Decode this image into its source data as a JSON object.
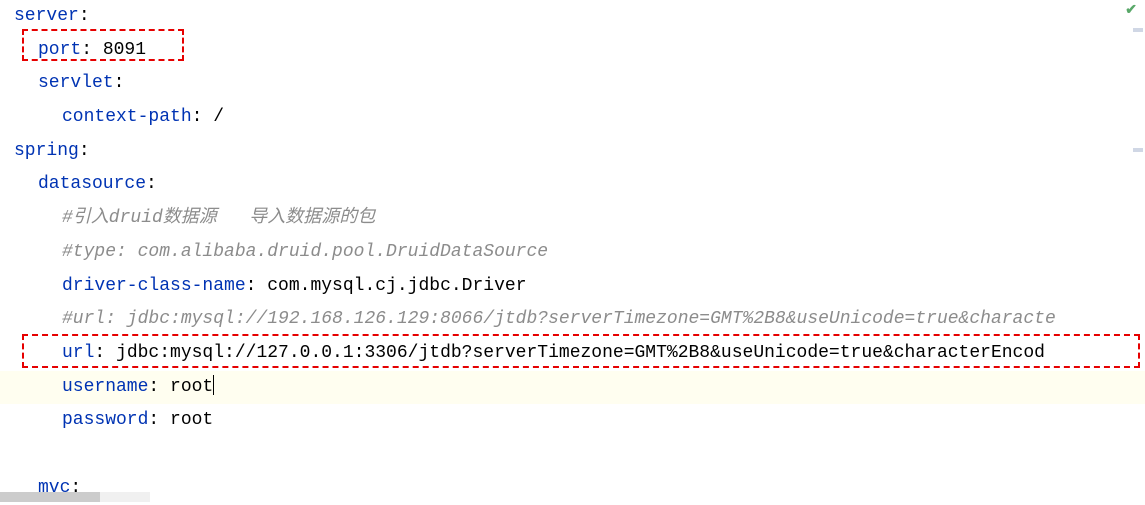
{
  "checkIcon": "✔",
  "lines": {
    "l1_key": "server",
    "l2_key": "port",
    "l2_val": "8091",
    "l3_key": "servlet",
    "l4_key": "context-path",
    "l4_val": "/",
    "l5_key": "spring",
    "l6_key": "datasource",
    "l7_comment": "#引入druid数据源   导入数据源的包",
    "l8_comment": "#type: com.alibaba.druid.pool.DruidDataSource",
    "l9_key": "driver-class-name",
    "l9_val": "com.mysql.cj.jdbc.Driver",
    "l10_comment": "#url: jdbc:mysql://192.168.126.129:8066/jtdb?serverTimezone=GMT%2B8&useUnicode=true&characte",
    "l11_key": "url",
    "l11_val": "jdbc:mysql://127.0.0.1:3306/jtdb?serverTimezone=GMT%2B8&useUnicode=true&characterEncod",
    "l12_key": "username",
    "l12_val": "root",
    "l13_key": "password",
    "l13_val": "root",
    "l14_key": "mvc"
  }
}
